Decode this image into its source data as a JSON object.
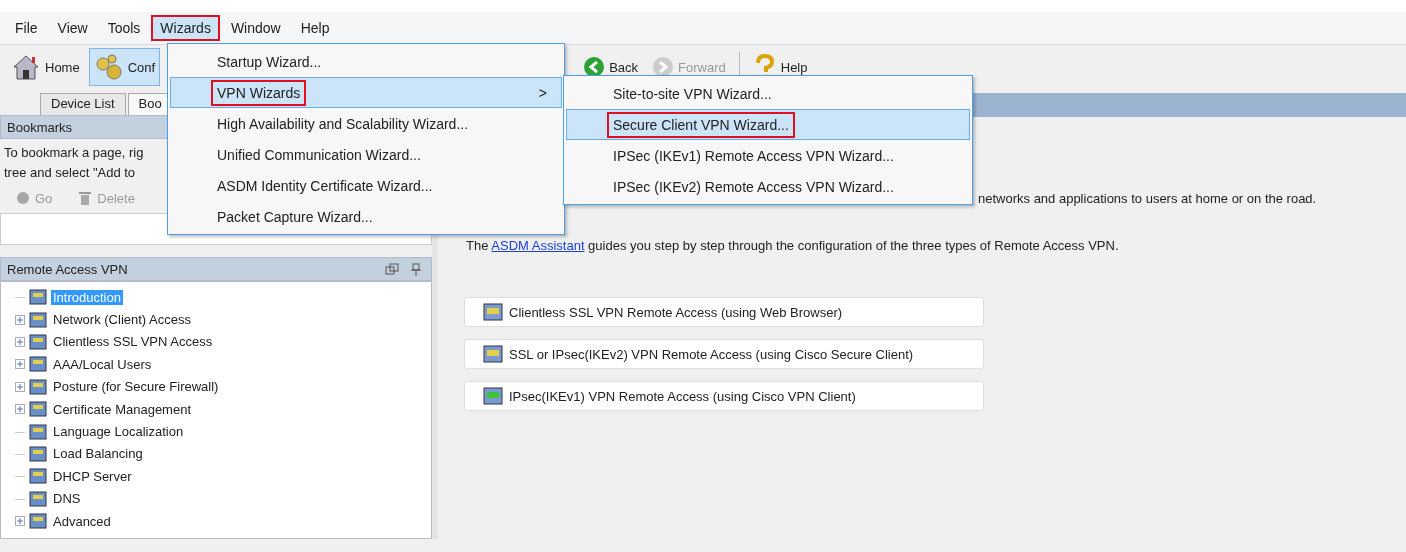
{
  "menu_bar": [
    {
      "label": "File",
      "selected": false,
      "highlighted": false
    },
    {
      "label": "View",
      "selected": false,
      "highlighted": false
    },
    {
      "label": "Tools",
      "selected": false,
      "highlighted": false
    },
    {
      "label": "Wizards",
      "selected": true,
      "highlighted": true
    },
    {
      "label": "Window",
      "selected": false,
      "highlighted": false
    },
    {
      "label": "Help",
      "selected": false,
      "highlighted": false
    }
  ],
  "toolbar": [
    {
      "label": "Home",
      "kind": "home",
      "selected": false,
      "disabled": false
    },
    {
      "label": "Conf",
      "kind": "config",
      "selected": true,
      "disabled": false
    },
    {
      "label": "Back",
      "kind": "back",
      "selected": false,
      "disabled": false
    },
    {
      "label": "Forward",
      "kind": "forward",
      "selected": false,
      "disabled": true
    },
    {
      "label": "Help",
      "kind": "help",
      "selected": false,
      "disabled": false
    }
  ],
  "tabs": [
    {
      "label": "Device List",
      "selected": false
    },
    {
      "label": "Boo",
      "selected": true
    }
  ],
  "bookmarks": {
    "title": "Bookmarks",
    "hint_lines": [
      "To bookmark a page, rig",
      "tree and select \"Add to"
    ],
    "actions": [
      {
        "label": "Go",
        "kind": "go",
        "disabled": true
      },
      {
        "label": "Delete",
        "kind": "delete",
        "disabled": true
      }
    ]
  },
  "nav_panel": {
    "title": "Remote Access VPN",
    "tree": [
      {
        "label": "Introduction",
        "kind": "leaf",
        "selected": true
      },
      {
        "label": "Network (Client) Access",
        "kind": "branch",
        "selected": false
      },
      {
        "label": "Clientless SSL VPN Access",
        "kind": "branch",
        "selected": false
      },
      {
        "label": "AAA/Local Users",
        "kind": "branch",
        "selected": false
      },
      {
        "label": "Posture (for Secure Firewall)",
        "kind": "branch",
        "selected": false
      },
      {
        "label": "Certificate Management",
        "kind": "branch",
        "selected": false
      },
      {
        "label": "Language Localization",
        "kind": "leaf",
        "selected": false
      },
      {
        "label": "Load Balancing",
        "kind": "leaf",
        "selected": false
      },
      {
        "label": "DHCP Server",
        "kind": "leaf",
        "selected": false
      },
      {
        "label": "DNS",
        "kind": "leaf",
        "selected": false
      },
      {
        "label": "Advanced",
        "kind": "branch",
        "selected": false
      }
    ]
  },
  "main": {
    "intro": "networks and applications to users at home or on the road.",
    "assistant": {
      "before": "The",
      "link": "ASDM Assistant",
      "after": "guides you step by step through the configuration of the three types of Remote Access VPN."
    },
    "options": [
      "Clientless SSL VPN Remote Access (using Web Browser)",
      "SSL or IPsec(IKEv2) VPN Remote Access (using Cisco Secure Client)",
      "IPsec(IKEv1) VPN Remote Access (using Cisco VPN Client)"
    ]
  },
  "wizards_menu": [
    {
      "label": "Startup Wizard...",
      "kind": "item",
      "selected": false,
      "highlighted": false
    },
    {
      "label": "VPN Wizards",
      "kind": "submenu",
      "selected": true,
      "highlighted": true
    },
    {
      "label": "High Availability and Scalability Wizard...",
      "kind": "item",
      "selected": false,
      "highlighted": false
    },
    {
      "label": "Unified Communication Wizard...",
      "kind": "item",
      "selected": false,
      "highlighted": false
    },
    {
      "label": "ASDM Identity Certificate Wizard...",
      "kind": "item",
      "selected": false,
      "highlighted": false
    },
    {
      "label": "Packet Capture Wizard...",
      "kind": "item",
      "selected": false,
      "highlighted": false
    }
  ],
  "submenu_arrow": ">",
  "vpn_submenu": [
    {
      "label": "Site-to-site VPN Wizard...",
      "selected": false,
      "highlighted": false
    },
    {
      "label": "Secure Client VPN Wizard...",
      "selected": true,
      "highlighted": true
    },
    {
      "label": "IPSec (IKEv1) Remote Access VPN Wizard...",
      "selected": false,
      "highlighted": false
    },
    {
      "label": "IPSec (IKEv2) Remote Access VPN Wizard...",
      "selected": false,
      "highlighted": false
    }
  ]
}
